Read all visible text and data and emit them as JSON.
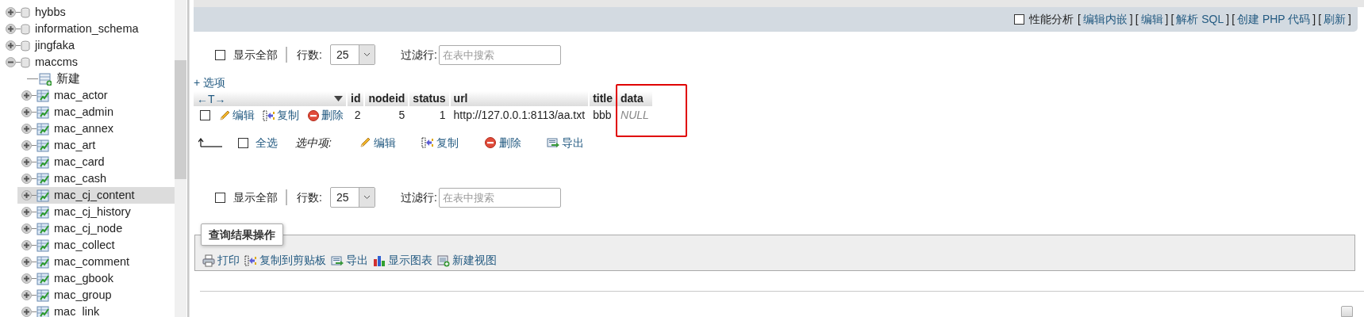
{
  "sidebar": {
    "items": [
      {
        "label": "hybbs",
        "kind": "database",
        "expanded": false,
        "selected": false
      },
      {
        "label": "information_schema",
        "kind": "database",
        "expanded": false,
        "selected": false
      },
      {
        "label": "jingfaka",
        "kind": "database",
        "expanded": false,
        "selected": false
      },
      {
        "label": "maccms",
        "kind": "database",
        "expanded": true,
        "selected": false,
        "children": [
          {
            "label": "新建",
            "kind": "new",
            "selected": false
          },
          {
            "label": "mac_actor",
            "kind": "table",
            "expanded": false,
            "selected": false
          },
          {
            "label": "mac_admin",
            "kind": "table",
            "expanded": false,
            "selected": false
          },
          {
            "label": "mac_annex",
            "kind": "table",
            "expanded": false,
            "selected": false
          },
          {
            "label": "mac_art",
            "kind": "table",
            "expanded": false,
            "selected": false
          },
          {
            "label": "mac_card",
            "kind": "table",
            "expanded": false,
            "selected": false
          },
          {
            "label": "mac_cash",
            "kind": "table",
            "expanded": false,
            "selected": false
          },
          {
            "label": "mac_cj_content",
            "kind": "table",
            "expanded": false,
            "selected": true
          },
          {
            "label": "mac_cj_history",
            "kind": "table",
            "expanded": false,
            "selected": false
          },
          {
            "label": "mac_cj_node",
            "kind": "table",
            "expanded": false,
            "selected": false
          },
          {
            "label": "mac_collect",
            "kind": "table",
            "expanded": false,
            "selected": false
          },
          {
            "label": "mac_comment",
            "kind": "table",
            "expanded": false,
            "selected": false
          },
          {
            "label": "mac_gbook",
            "kind": "table",
            "expanded": false,
            "selected": false
          },
          {
            "label": "mac_group",
            "kind": "table",
            "expanded": false,
            "selected": false
          },
          {
            "label": "mac_link",
            "kind": "table",
            "expanded": false,
            "selected": false
          }
        ]
      }
    ]
  },
  "query_bar": {
    "profiling": {
      "label": "性能分析",
      "checked": false
    },
    "segments": [
      {
        "kind": "bracket",
        "text": "["
      },
      {
        "kind": "link",
        "text": "编辑内嵌"
      },
      {
        "kind": "bracket",
        "text": "]"
      },
      {
        "kind": "bracket",
        "text": "["
      },
      {
        "kind": "link",
        "text": "编辑"
      },
      {
        "kind": "bracket",
        "text": "]"
      },
      {
        "kind": "bracket",
        "text": "["
      },
      {
        "kind": "link",
        "text": "解析 SQL"
      },
      {
        "kind": "bracket",
        "text": "]"
      },
      {
        "kind": "bracket",
        "text": "["
      },
      {
        "kind": "link",
        "text": "创建 PHP 代码"
      },
      {
        "kind": "bracket",
        "text": "]"
      },
      {
        "kind": "bracket",
        "text": "["
      },
      {
        "kind": "link",
        "text": "刷新"
      },
      {
        "kind": "bracket",
        "text": "]"
      }
    ]
  },
  "navigation_top": {
    "show_all": {
      "label": "显示全部",
      "checked": false
    },
    "rows_label": "行数:",
    "rows_value": "25",
    "filter_label": "过滤行:",
    "filter_placeholder": "在表中搜索"
  },
  "options_link": "+ 选项",
  "table": {
    "resize_handle": "←T→",
    "columns": [
      {
        "label": "id",
        "highlighted": false
      },
      {
        "label": "nodeid",
        "highlighted": false
      },
      {
        "label": "status",
        "highlighted": false
      },
      {
        "label": "url",
        "highlighted": false
      },
      {
        "label": "title",
        "highlighted": false
      },
      {
        "label": "data",
        "highlighted": true
      }
    ],
    "rows": [
      {
        "checked": false,
        "actions": [
          {
            "kind": "edit",
            "label": "编辑"
          },
          {
            "kind": "copy",
            "label": "复制"
          },
          {
            "kind": "delete",
            "label": "删除"
          }
        ],
        "cells": [
          {
            "kind": "number",
            "text": "2"
          },
          {
            "kind": "number",
            "text": "5"
          },
          {
            "kind": "number",
            "text": "1"
          },
          {
            "kind": "text",
            "text": "http://127.0.0.1:8113/aa.txt"
          },
          {
            "kind": "text",
            "text": "bbb"
          },
          {
            "kind": "null",
            "text": "NULL"
          }
        ]
      }
    ]
  },
  "bulk_actions": {
    "check_all": {
      "label": "全选",
      "checked": false
    },
    "with_selected": "选中项:",
    "actions": [
      {
        "kind": "edit",
        "label": "编辑"
      },
      {
        "kind": "copy",
        "label": "复制"
      },
      {
        "kind": "delete",
        "label": "删除"
      },
      {
        "kind": "export",
        "label": "导出"
      }
    ]
  },
  "navigation_bottom": {
    "show_all": {
      "label": "显示全部",
      "checked": false
    },
    "rows_label": "行数:",
    "rows_value": "25",
    "filter_label": "过滤行:",
    "filter_placeholder": "在表中搜索"
  },
  "query_results_operations": {
    "legend": "查询结果操作",
    "actions": [
      {
        "kind": "print",
        "label": "打印"
      },
      {
        "kind": "copy",
        "label": "复制到剪贴板"
      },
      {
        "kind": "export",
        "label": "导出"
      },
      {
        "kind": "chart",
        "label": "显示图表"
      },
      {
        "kind": "new_view",
        "label": "新建视图"
      }
    ]
  }
}
